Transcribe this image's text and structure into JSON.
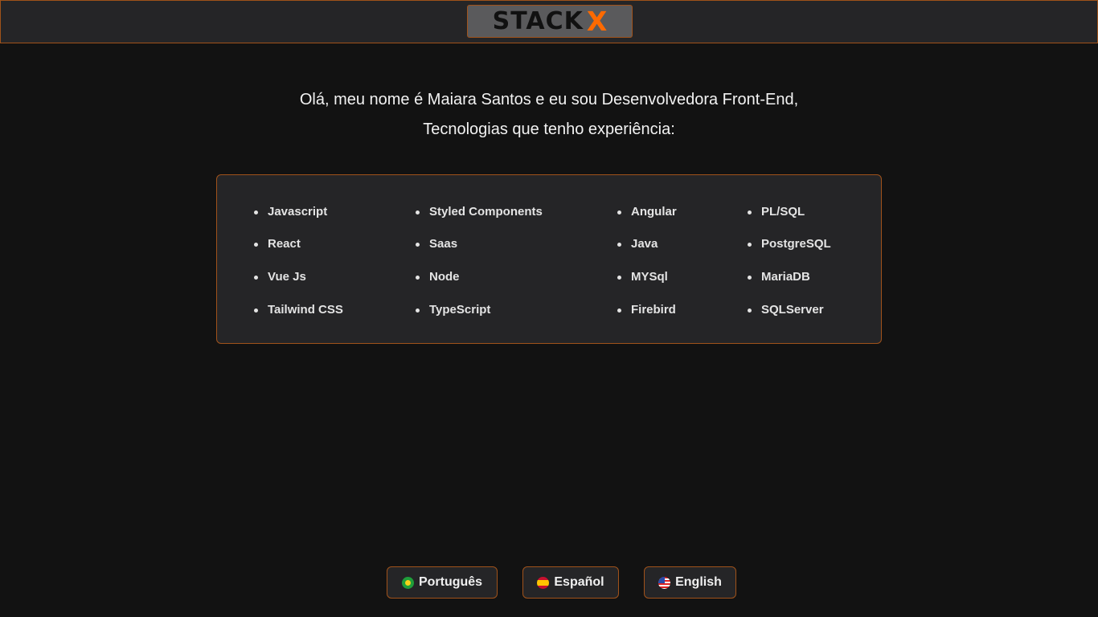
{
  "header": {
    "logo_text": "STACK",
    "logo_accent": "X"
  },
  "intro": {
    "line1": "Olá, meu nome é Maiara Santos e eu sou Desenvolvedora Front-End,",
    "line2": "Tecnologias que tenho experiência:"
  },
  "technologies": {
    "columns": [
      [
        "Javascript",
        "React",
        "Vue Js",
        "Tailwind CSS"
      ],
      [
        "Styled Components",
        "Saas",
        "Node",
        "TypeScript"
      ],
      [
        "Angular",
        "Java",
        "MYSql",
        "Firebird"
      ],
      [
        "PL/SQL",
        "PostgreSQL",
        "MariaDB",
        "SQLServer"
      ]
    ]
  },
  "languages": {
    "portuguese": "Português",
    "spanish": "Español",
    "english": "English"
  },
  "colors": {
    "background": "#121212",
    "panel": "#252527",
    "accent_border": "#a0521a",
    "logo_accent": "#ff6a00"
  },
  "icons": {
    "portuguese": "brazil-flag-icon",
    "spanish": "spain-flag-icon",
    "english": "usa-flag-icon"
  }
}
